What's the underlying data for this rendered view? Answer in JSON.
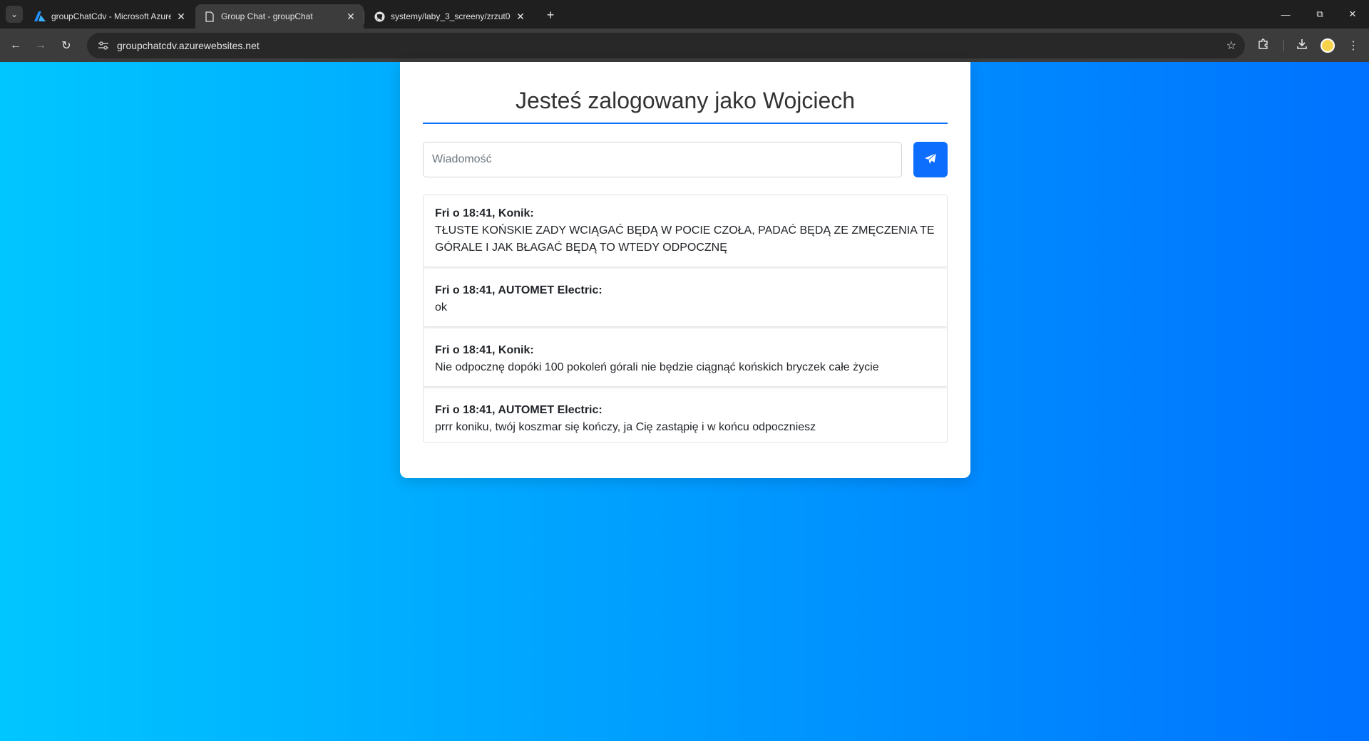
{
  "browser": {
    "tabs": [
      {
        "title": "groupChatCdv - Microsoft Azure",
        "icon": "azure-icon",
        "active": false
      },
      {
        "title": "Group Chat - groupChat",
        "icon": "page-icon",
        "active": true
      },
      {
        "title": "systemy/laby_3_screeny/zrzut0001",
        "icon": "github-icon",
        "active": false
      }
    ],
    "url": "groupchatcdv.azurewebsites.net"
  },
  "page": {
    "heading": "Jesteś zalogowany jako Wojciech",
    "input_placeholder": "Wiadomość",
    "input_value": "",
    "send_icon": "send-icon",
    "messages": [
      {
        "meta": "Fri o 18:41, Konik:",
        "text": "TŁUSTE KOŃSKIE ZADY WCIĄGAĆ BĘDĄ W POCIE CZOŁA, PADAĆ BĘDĄ ZE ZMĘCZENIA TE GÓRALE I JAK BŁAGAĆ BĘDĄ TO WTEDY ODPOCZNĘ"
      },
      {
        "meta": "Fri o 18:41, AUTOMET Electric:",
        "text": "ok"
      },
      {
        "meta": "Fri o 18:41, Konik:",
        "text": "Nie odpocznę dopóki 100 pokoleń górali nie będzie ciągnąć końskich bryczek całe życie"
      },
      {
        "meta": "Fri o 18:41, AUTOMET Electric:",
        "text": "prrr koniku, twój koszmar się kończy, ja Cię zastąpię i w końcu odpoczniesz"
      }
    ]
  },
  "colors": {
    "gradient_start": "#00c6ff",
    "gradient_end": "#0072ff",
    "accent": "#0d6efd"
  }
}
